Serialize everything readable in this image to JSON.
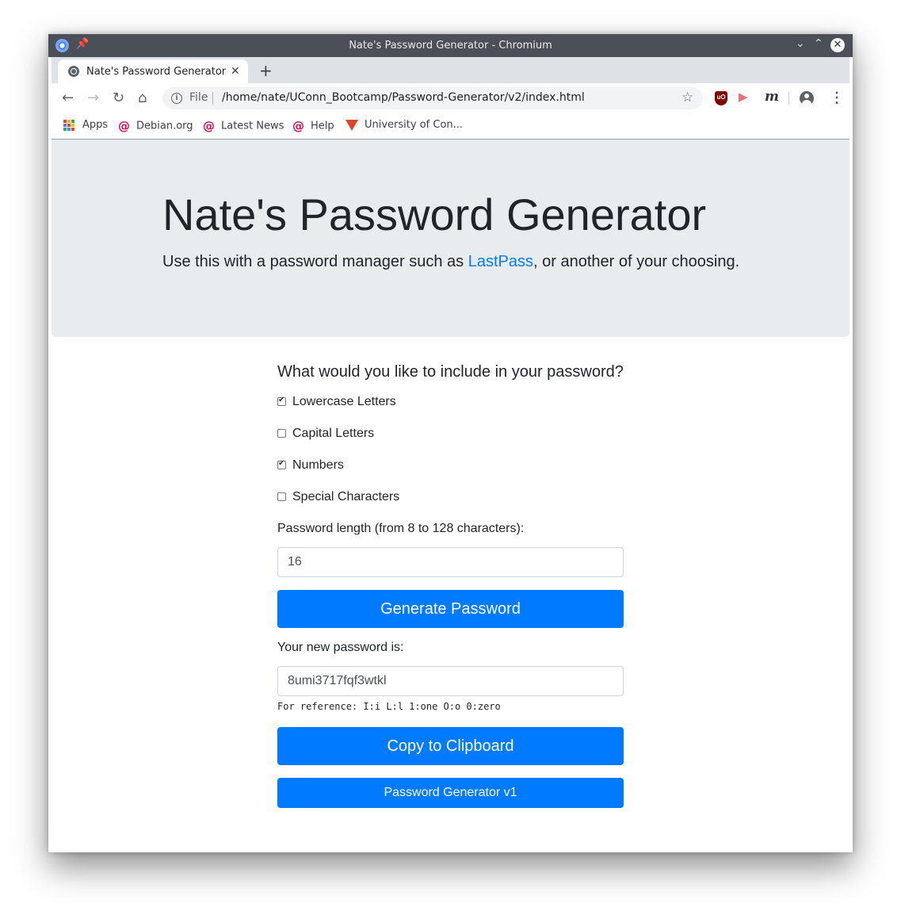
{
  "window": {
    "title": "Nate's Password Generator - Chromium",
    "controls": {
      "minimize": "⌄",
      "maximize": "⌃",
      "close": "✕"
    }
  },
  "tab": {
    "title": "Nate's Password Generator",
    "close": "✕",
    "new_tab": "+"
  },
  "toolbar": {
    "scheme": "File",
    "url": "/home/nate/UConn_Bootcamp/Password-Generator/v2/index.html"
  },
  "bookmarks": [
    "Apps",
    "Debian.org",
    "Latest News",
    "Help",
    "University of Con..."
  ],
  "colors": {
    "primary": "#007bff",
    "jumbotron_bg": "#e9ecef",
    "text": "#212529",
    "link": "#007bff"
  },
  "page": {
    "heading": "Nate's Password Generator",
    "lead_before": "Use this with a password manager such as ",
    "lead_link": "LastPass",
    "lead_after": ", or another of your choosing.",
    "question": "What would you like to include in your password?",
    "options": [
      {
        "label": "Lowercase Letters",
        "checked": true
      },
      {
        "label": "Capital Letters",
        "checked": false
      },
      {
        "label": "Numbers",
        "checked": true
      },
      {
        "label": "Special Characters",
        "checked": false
      }
    ],
    "length_label": "Password length (from 8 to 128 characters):",
    "length_value": "16",
    "generate_button": "Generate Password",
    "result_label": "Your new password is:",
    "result_value": "8umi3717fqf3wtkl",
    "reference": "For reference: I:i L:l 1:one O:o 0:zero",
    "copy_button": "Copy to Clipboard",
    "v1_button": "Password Generator v1"
  }
}
